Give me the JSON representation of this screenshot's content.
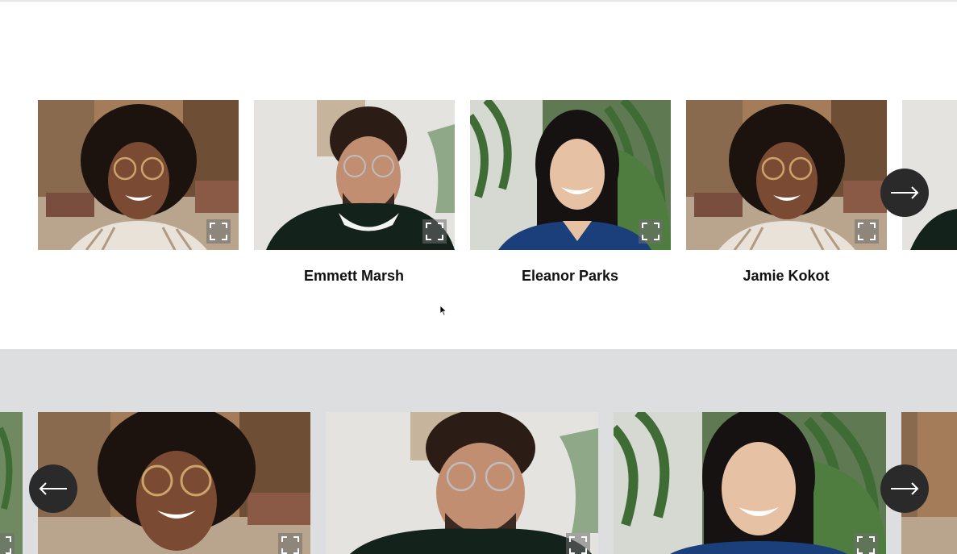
{
  "carousel_top": {
    "slides": [
      {
        "name": "",
        "photo": "woman-curly-hair-glasses"
      },
      {
        "name": "Emmett Marsh",
        "photo": "man-glasses-sweater"
      },
      {
        "name": "Eleanor Parks",
        "photo": "woman-straight-hair-plants"
      },
      {
        "name": "Jamie Kokot",
        "photo": "woman-curly-hair-glasses"
      }
    ],
    "next_icon": "arrow-right-icon"
  },
  "carousel_bottom": {
    "slides": [
      {
        "photo": "woman-curly-hair-glasses"
      },
      {
        "photo": "man-glasses-sweater"
      },
      {
        "photo": "woman-straight-hair-plants"
      }
    ],
    "prev_icon": "arrow-left-icon",
    "next_icon": "arrow-right-icon"
  },
  "colors": {
    "band_background": "#dddee0",
    "arrow_button": "#2a2a2a"
  }
}
